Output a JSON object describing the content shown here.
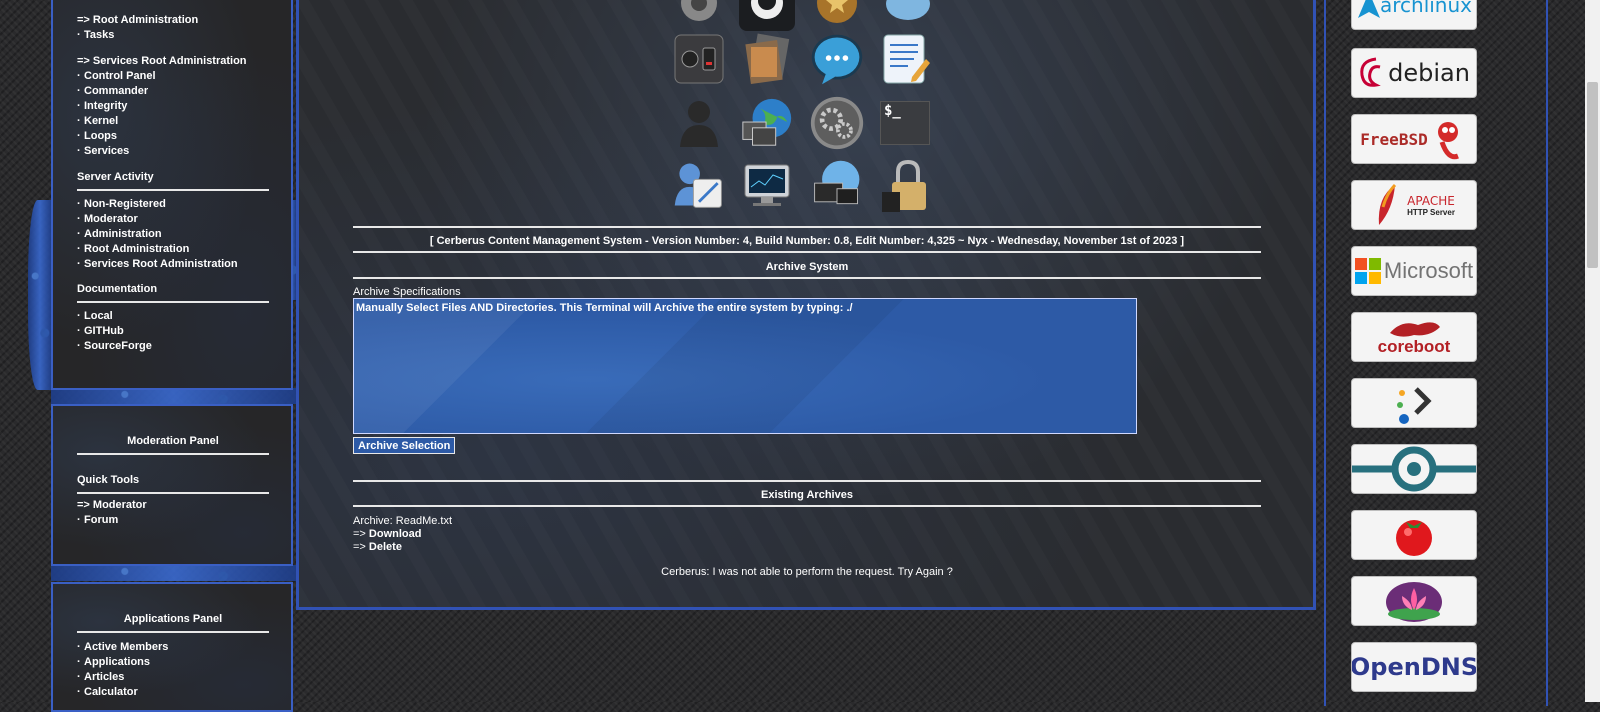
{
  "sidebar": {
    "nav": {
      "root_admin_header": "=> Root Administration",
      "tasks": "Tasks",
      "services_root_header": "=> Services Root Administration",
      "items": [
        "Control Panel",
        "Commander",
        "Integrity",
        "Kernel",
        "Loops",
        "Services"
      ],
      "bullet": "·"
    },
    "server_activity": {
      "heading": "Server Activity",
      "items": [
        "Non-Registered",
        "Moderator",
        "Administration",
        "Root Administration",
        "Services Root Administration"
      ]
    },
    "documentation": {
      "heading": "Documentation",
      "items": [
        "Local",
        "GITHub",
        "SourceForge"
      ]
    },
    "moderation_panel": {
      "title": "Moderation Panel",
      "quick_tools": "Quick Tools",
      "moderator_link": "=> Moderator",
      "forum": "Forum"
    },
    "applications_panel": {
      "title": "Applications Panel",
      "items": [
        "Active Members",
        "Applications",
        "Articles",
        "Calculator"
      ]
    }
  },
  "main": {
    "version_banner": "[ Cerberus Content Management System - Version Number: 4, Build Number: 0.8, Edit Number: 4,325 ~ Nyx - Wednesday, November 1st of 2023 ]",
    "archive_system_title": "Archive System",
    "archive_spec_label": "Archive Specifications",
    "archive_spec_value": "Manually Select Files AND Directories. This Terminal will Archive the entire system by typing: ./",
    "archive_button": "Archive Selection",
    "existing_archives_title": "Existing Archives",
    "archive_file_label": "Archive: ReadMe.txt",
    "arrow": "=>",
    "download": "Download",
    "delete": "Delete",
    "status_message": "Cerberus: I was not able to perform the request. Try Again ?",
    "terminal_glyph": "$_"
  },
  "right_logos": {
    "archlinux": "archlinux",
    "debian": "debian",
    "freebsd": "FreeBSD",
    "apache_1": "APACHE",
    "apache_2": "HTTP Server",
    "microsoft": "Microsoft",
    "coreboot": "coreboot",
    "opendns": "OpenDNS"
  }
}
